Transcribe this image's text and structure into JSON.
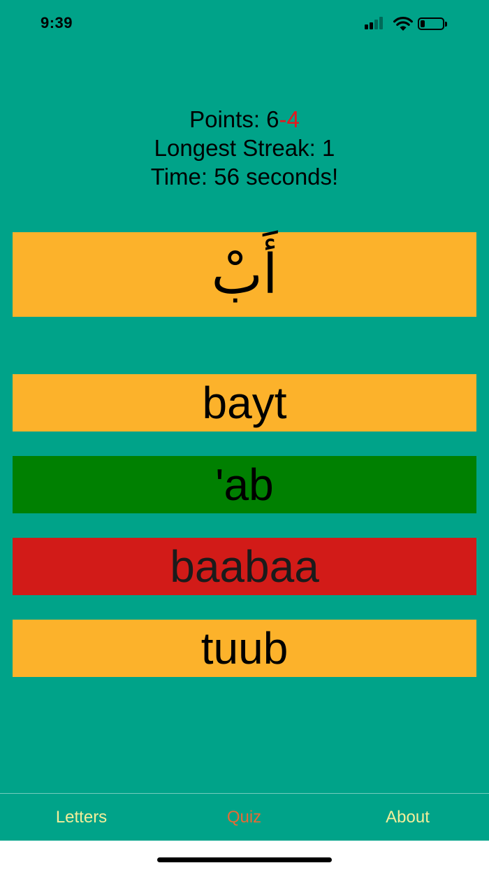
{
  "status_bar": {
    "time": "9:39",
    "icons": [
      "cellular-signal-icon",
      "wifi-icon",
      "battery-icon"
    ]
  },
  "score": {
    "points_label": "Points: ",
    "points_correct": "6",
    "points_separator": "-",
    "points_wrong": "4",
    "longest_streak": "Longest Streak: 1",
    "time": "Time: 56 seconds!"
  },
  "quiz": {
    "prompt": "أَبْ",
    "options": [
      {
        "label": "bayt",
        "state": "neutral"
      },
      {
        "label": "'ab",
        "state": "correct"
      },
      {
        "label": "baabaa",
        "state": "wrong"
      },
      {
        "label": "tuub",
        "state": "neutral"
      }
    ]
  },
  "tabbar": {
    "items": [
      {
        "label": "Letters",
        "selected": false
      },
      {
        "label": "Quiz",
        "selected": true
      },
      {
        "label": "About",
        "selected": false
      }
    ]
  },
  "colors": {
    "background": "#00A389",
    "card": "#FCB22B",
    "correct": "#008001",
    "wrong": "#D21B18",
    "negative_points": "#E8171D",
    "tab_inactive": "#F2EE9A",
    "tab_active": "#E66A35"
  }
}
